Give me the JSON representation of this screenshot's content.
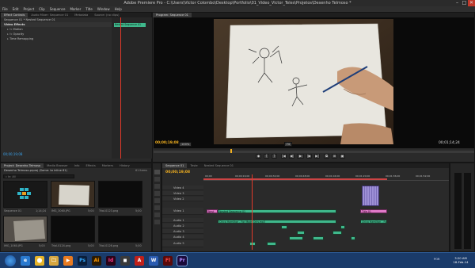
{
  "app": {
    "title": "Adobe Premiere Pro - C:\\Users\\Victor Colombo\\Desktop\\Portfolio\\01_Video_Victor_Teles\\Projetos\\Desenho Telmoso *",
    "minimize": "–",
    "maximize": "□",
    "close": "✕"
  },
  "menu": [
    "File",
    "Edit",
    "Project",
    "Clip",
    "Sequence",
    "Marker",
    "Title",
    "Window",
    "Help"
  ],
  "effect_controls": {
    "tabs": [
      "Effect Controls",
      "Audio Mixer: Sequence 01",
      "Metadata",
      "Source: (no clips)"
    ],
    "breadcrumb": "Sequence 01 * Nested Sequence 01",
    "section": "Video Effects",
    "rows": [
      "Motion",
      "Opacity",
      "Time Remapping"
    ],
    "clip_label": "Nested Sequence 01",
    "timecode": "00;00;19;08"
  },
  "program": {
    "tab": "Program: Sequence 01",
    "timecode_current": "00;00;19;08",
    "fit": "Fit",
    "zoom": "100%",
    "timecode_duration": "00;01;14;24",
    "controls": [
      "◆",
      "{",
      "}",
      "|◀",
      "◀|",
      "▶",
      "|▶",
      "▶|",
      "⧉",
      "⊞",
      "▣"
    ]
  },
  "project": {
    "tabs": [
      "Project: Desenho Telmoso",
      "Media Browser",
      "Info",
      "Effects",
      "Markers",
      "History"
    ],
    "name": "Desenho Telmoso.prproj (Same: to inline 61)",
    "in_label": "In: All",
    "count": "61 Items",
    "items": [
      {
        "name": "Sequence 01",
        "duration": "1;14;24"
      },
      {
        "name": "IMG_3060.JPG",
        "duration": "5;00"
      },
      {
        "name": "Trial-0123.png",
        "duration": "5;00"
      },
      {
        "name": "Trial-0125.png",
        "duration": "5;00"
      },
      {
        "name": "IMG_1060.JPG",
        "duration": "5;00"
      },
      {
        "name": "Trial-0124.png",
        "duration": "5;00"
      },
      {
        "name": "Trial-0126.png",
        "duration": "5;00"
      },
      {
        "name": "Trial-0127.png",
        "duration": "5;00"
      }
    ]
  },
  "timeline": {
    "tabs": [
      "Sequence 01",
      "Teste",
      "Nested Sequence 01"
    ],
    "timecode": "00;00;19;08",
    "ruler": [
      "00;00",
      "00;00;16;00",
      "00;00;32;00",
      "00;00;48;00",
      "00;01;04;00",
      "00;01;20;00",
      "00;01;36;00",
      "00;01;52;00",
      "00;02;08;00"
    ],
    "video_tracks": [
      "Video 4",
      "Video 3",
      "Video 2",
      "Video 1"
    ],
    "audio_tracks": [
      "Audio 1",
      "Audio 2",
      "Audio 3",
      "Audio 4",
      "Audio 5",
      "Master"
    ],
    "clips": {
      "v1_a": "Nest",
      "v1_b": "Nested Sequence 01",
      "v1_c": "Title 01",
      "a1": "Chico Hamilton - For Mods Only.mp3",
      "a1_b": "Chico Hamilton - For"
    }
  },
  "taskbar": {
    "apps": [
      "e",
      "⬤",
      "🗀",
      "▶",
      "Ps",
      "Ai",
      "Id",
      "◼",
      "A",
      "W",
      "Fl",
      "Pr"
    ],
    "lang": "POR",
    "time": "3:20 AM",
    "date": "18-Feb-14"
  },
  "colors": {
    "blue_tc": "#3aa0e8",
    "orange_tc": "#f2b020",
    "playhead": "#e23a2a",
    "clip_green": "#3fb88c",
    "clip_purple": "#9d8fd6",
    "clip_pink": "#e07ac8",
    "taskbar": "#1a3b6a"
  }
}
